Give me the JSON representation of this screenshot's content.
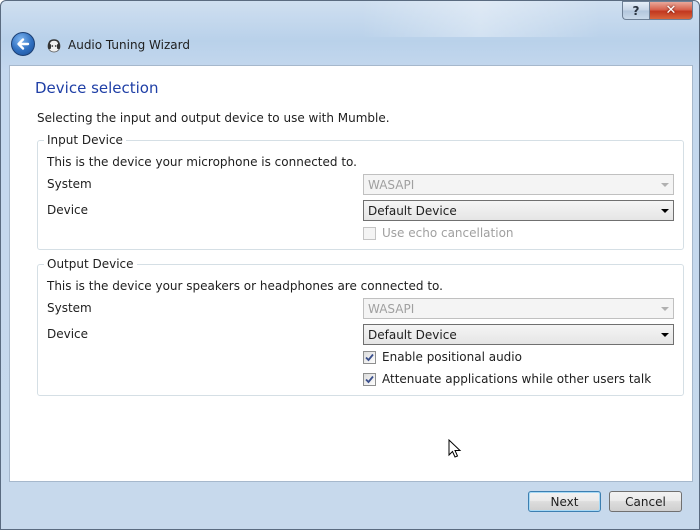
{
  "window": {
    "title": "Audio Tuning Wizard",
    "help_glyph": "?",
    "close_glyph": "✕"
  },
  "page": {
    "heading": "Device selection",
    "intro": "Selecting the input and output device to use with Mumble."
  },
  "input_device": {
    "title": "Input Device",
    "description": "This is the device your microphone is connected to.",
    "system_label": "System",
    "system_value": "WASAPI",
    "device_label": "Device",
    "device_value": "Default Device",
    "echo_cancellation_label": "Use echo cancellation",
    "echo_cancellation_checked": false,
    "echo_cancellation_enabled": false
  },
  "output_device": {
    "title": "Output Device",
    "description": "This is the device your speakers or headphones are connected to.",
    "system_label": "System",
    "system_value": "WASAPI",
    "device_label": "Device",
    "device_value": "Default Device",
    "positional_audio_label": "Enable positional audio",
    "positional_audio_checked": true,
    "attenuate_label": "Attenuate applications while other users talk",
    "attenuate_checked": true
  },
  "buttons": {
    "next": "Next",
    "cancel": "Cancel"
  },
  "colors": {
    "heading": "#1f3fa6",
    "close_button": "#c2371f",
    "default_button_border": "#3c7fb1"
  },
  "icons": {
    "back": "back-arrow-icon",
    "app": "mumble-logo-icon",
    "check": "check-mark-icon",
    "dropdown": "chevron-down-icon",
    "cursor": "mouse-cursor-icon"
  }
}
